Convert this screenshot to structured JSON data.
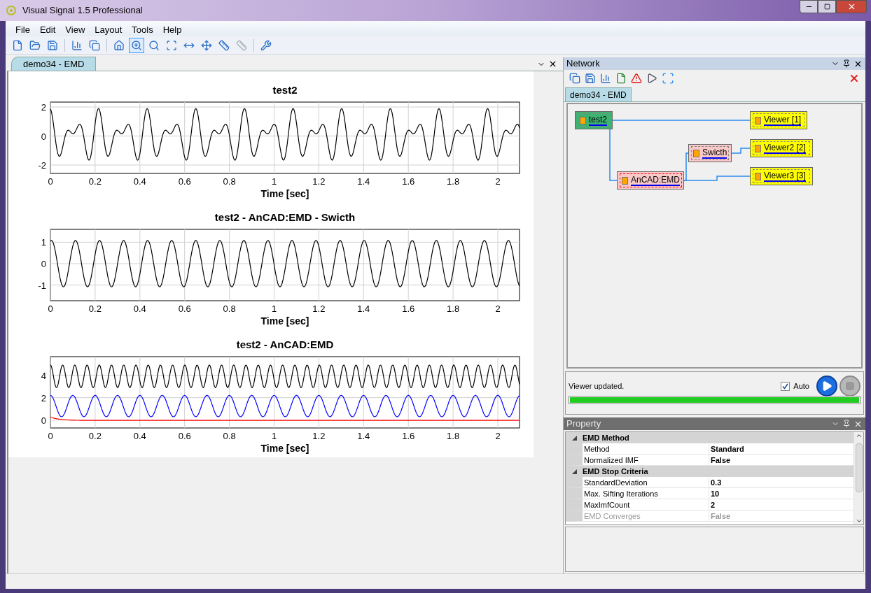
{
  "window": {
    "title": "Visual Signal 1.5 Professional"
  },
  "menu": [
    "File",
    "Edit",
    "View",
    "Layout",
    "Tools",
    "Help"
  ],
  "toolbar": [
    [
      {
        "kind": "new",
        "pressed": false,
        "disabled": false
      },
      {
        "kind": "open",
        "pressed": false,
        "disabled": false
      },
      {
        "kind": "save",
        "pressed": false,
        "disabled": false
      }
    ],
    [
      {
        "kind": "chart-copy",
        "pressed": false,
        "disabled": false
      },
      {
        "kind": "chart-save",
        "pressed": false,
        "disabled": false
      }
    ],
    [
      {
        "kind": "home",
        "pressed": false,
        "disabled": false
      },
      {
        "kind": "zoom",
        "pressed": true,
        "disabled": false
      },
      {
        "kind": "zoom-v",
        "pressed": false,
        "disabled": false
      },
      {
        "kind": "zoom-box",
        "pressed": false,
        "disabled": false
      },
      {
        "kind": "zoom-h",
        "pressed": false,
        "disabled": false
      },
      {
        "kind": "zoom-xy",
        "pressed": false,
        "disabled": false
      },
      {
        "kind": "axis",
        "pressed": false,
        "disabled": false
      },
      {
        "kind": "axis",
        "pressed": false,
        "disabled": true
      }
    ],
    [
      {
        "kind": "tools",
        "pressed": false,
        "disabled": false
      }
    ]
  ],
  "document": {
    "tab": "demo34 - EMD",
    "plots": [
      {
        "title": "test2",
        "xlabel": "Time [sec]",
        "xticks": [
          "0",
          "0.2",
          "0.4",
          "0.6",
          "0.8",
          "1",
          "1.2",
          "1.4",
          "1.6",
          "1.8",
          "2"
        ],
        "yticks": [
          "2",
          "0",
          "-2"
        ],
        "kind": "signal"
      },
      {
        "title": "test2 - AnCAD:EMD - Swicth",
        "xlabel": "Time [sec]",
        "xticks": [
          "0",
          "0.2",
          "0.4",
          "0.6",
          "0.8",
          "1",
          "1.2",
          "1.4",
          "1.6",
          "1.8",
          "2"
        ],
        "yticks": [
          "1",
          "0",
          "-1"
        ],
        "kind": "imf"
      },
      {
        "title": "test2 - AnCAD:EMD",
        "xlabel": "Time [sec]",
        "xticks": [
          "0",
          "0.2",
          "0.4",
          "0.6",
          "0.8",
          "1",
          "1.2",
          "1.4",
          "1.6",
          "1.8",
          "2"
        ],
        "yticks": [
          "4",
          "2",
          "0"
        ],
        "kind": "stack"
      }
    ]
  },
  "network": {
    "title": "Network",
    "tab": "demo34 - EMD",
    "nodes": [
      {
        "label": "test2",
        "kind": "source",
        "selected": false
      },
      {
        "label": "Viewer [1]",
        "kind": "viewer",
        "selected": false
      },
      {
        "label": "Swicth",
        "kind": "process",
        "selected": false
      },
      {
        "label": "Viewer2 [2]",
        "kind": "viewer",
        "selected": false
      },
      {
        "label": "AnCAD:EMD",
        "kind": "process",
        "selected": true
      },
      {
        "label": "Viewer3 [3]",
        "kind": "viewer",
        "selected": false
      }
    ],
    "status": "Viewer updated.",
    "auto": {
      "label": "Auto",
      "checked": true
    },
    "progress": {
      "level": 1
    }
  },
  "property": {
    "title": "Property",
    "categories": [
      {
        "name": "EMD Method",
        "expanded": true,
        "rows": [
          {
            "name": "Method",
            "value": "Standard",
            "disabled": false
          },
          {
            "name": "Normalized IMF",
            "value": "False",
            "disabled": false
          }
        ]
      },
      {
        "name": "EMD Stop Criteria",
        "expanded": true,
        "rows": [
          {
            "name": "StandardDeviation",
            "value": "0.3",
            "disabled": false
          },
          {
            "name": "Max. Sifting Iterations",
            "value": "10",
            "disabled": false
          },
          {
            "name": "MaxImfCount",
            "value": "2",
            "disabled": false
          },
          {
            "name": "EMD Converges",
            "value": "False",
            "disabled": true
          }
        ]
      }
    ]
  }
}
